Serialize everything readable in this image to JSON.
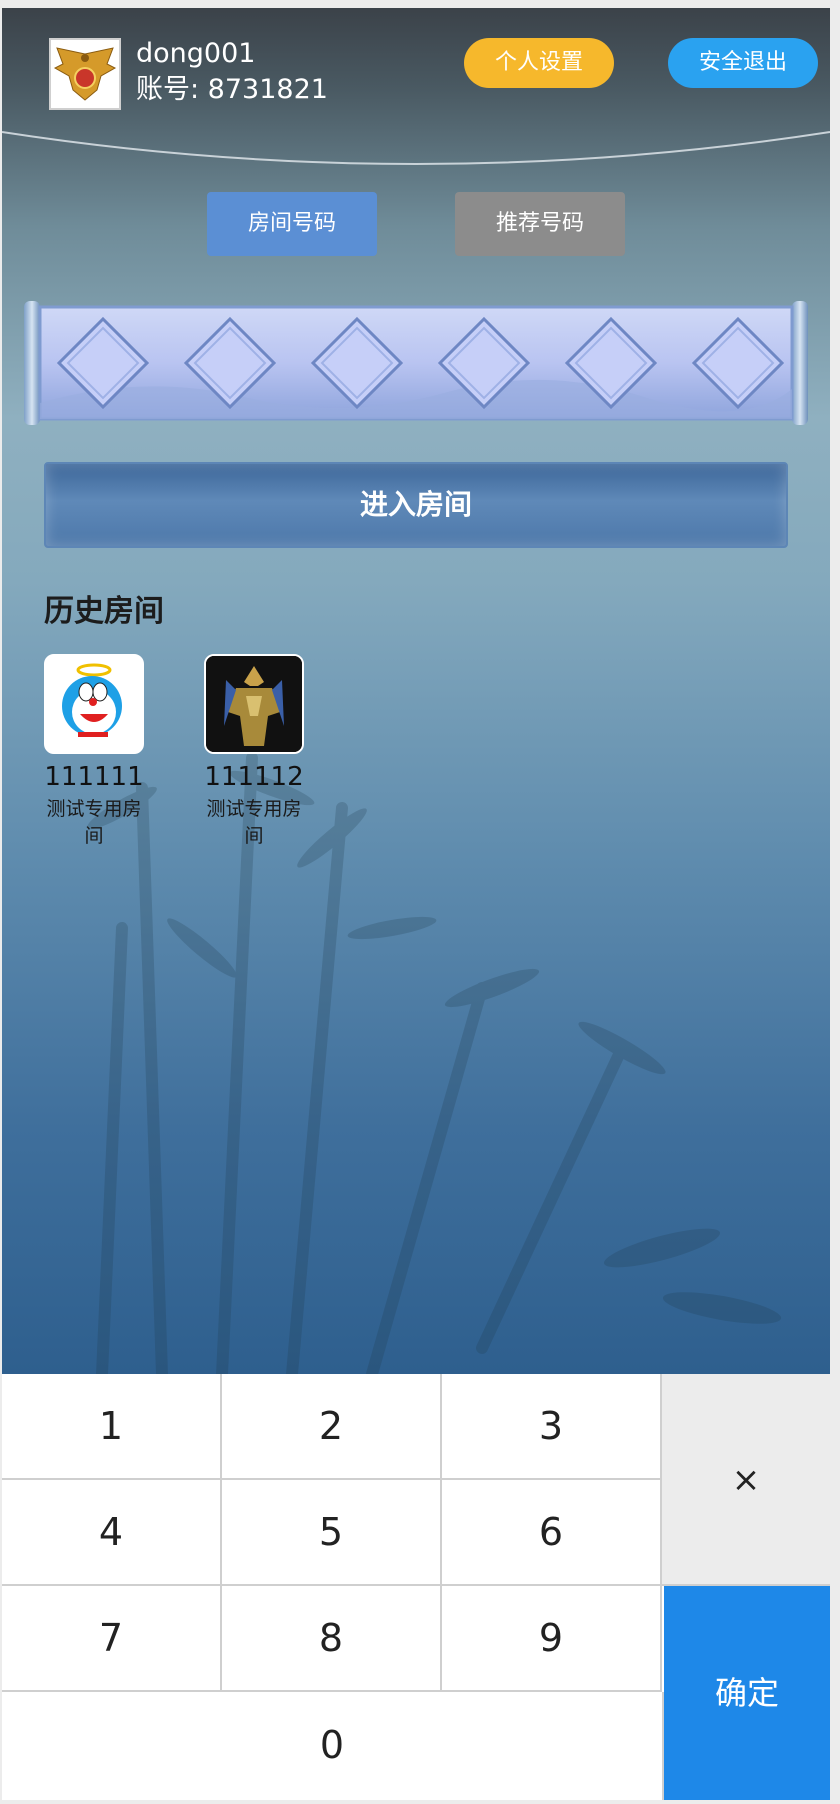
{
  "header": {
    "username": "dong001",
    "account": "账号: 8731821",
    "settings_label": "个人设置",
    "logout_label": "安全退出",
    "colors": {
      "settings": "#f6b82c",
      "logout": "#2aa2f0"
    }
  },
  "tabs": [
    {
      "label": "房间号码",
      "active": true
    },
    {
      "label": "推荐号码",
      "active": false
    }
  ],
  "room_input": {
    "slots": 6,
    "icon": "diamond-slot-icon"
  },
  "enter_label": "进入房间",
  "history": {
    "title": "历史房间",
    "rooms": [
      {
        "number": "111111",
        "name": "测试专用房间",
        "icon": "doraemon-avatar"
      },
      {
        "number": "111112",
        "name": "测试专用房间",
        "icon": "armored-robot-avatar"
      }
    ]
  },
  "keypad": {
    "keys": [
      "1",
      "2",
      "3",
      "4",
      "5",
      "6",
      "7",
      "8",
      "9",
      "0"
    ],
    "delete_label": "×",
    "confirm_label": "确定",
    "confirm_color": "#1e88e8"
  }
}
